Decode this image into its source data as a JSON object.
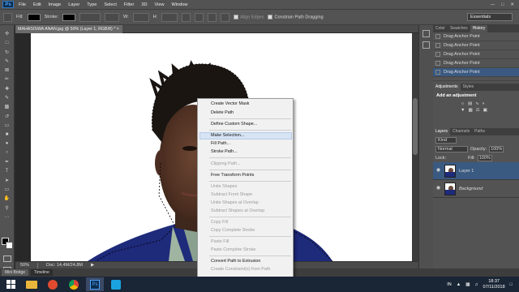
{
  "app": {
    "logo": "Ps"
  },
  "menu": [
    "File",
    "Edit",
    "Image",
    "Layer",
    "Type",
    "Select",
    "Filter",
    "3D",
    "View",
    "Window"
  ],
  "options_bar": {
    "fill_label": "Fill:",
    "stroke_label": "Stroke:",
    "w_label": "W:",
    "h_label": "H:",
    "align_edges": "Align Edges",
    "constrain": "Constrain Path Dragging",
    "workspace": "Essentials"
  },
  "document": {
    "tab_title": "MAHASISWA ANAN.jpg @ 50% (Layer 1, RGB/8) *",
    "zoom": "50%",
    "doc_size": "Doc: 14,4M/24,8M"
  },
  "bottom_tabs": [
    "Mini Bridge",
    "Timeline"
  ],
  "history": {
    "tabs": [
      "Color",
      "Swatches",
      "History"
    ],
    "items": [
      "Drag Anchor Point",
      "Drag Anchor Point",
      "Drag Anchor Point",
      "Drag Anchor Point",
      "Drag Anchor Point"
    ]
  },
  "adjustments": {
    "tabs": [
      "Adjustments",
      "Styles"
    ],
    "heading": "Add an adjustment"
  },
  "layers": {
    "tabs": [
      "Layers",
      "Channels",
      "Paths"
    ],
    "kind": "Kind",
    "blend_mode": "Normal",
    "opacity_label": "Opacity:",
    "opacity_value": "100%",
    "lock_label": "Lock:",
    "fill_label": "Fill:",
    "fill_value": "100%",
    "items": [
      "Layer 1",
      "Background"
    ]
  },
  "context_menu": {
    "highlighted": "Make Selection...",
    "items": [
      "Create Vector Mask",
      "Delete Path",
      "Define Custom Shape...",
      "Make Selection...",
      "Fill Path...",
      "Stroke Path...",
      "Clipping Path...",
      "Free Transform Points",
      "Unite Shapes",
      "Subtract Front Shape",
      "Unite Shapes at Overlap",
      "Subtract Shapes at Overlap",
      "Copy Fill",
      "Copy Complete Stroke",
      "Paste Fill",
      "Paste Complete Stroke",
      "Convert Path to Extrusion",
      "Create Constraint(s) from Path"
    ]
  },
  "taskbar": {
    "lang": "IN",
    "time": "18:37",
    "date": "07/11/2018"
  },
  "colors": {
    "highlight": "#3a5a82",
    "menu_highlight": "#d6e4f4",
    "shirt_blue": "#1e2a7a"
  }
}
